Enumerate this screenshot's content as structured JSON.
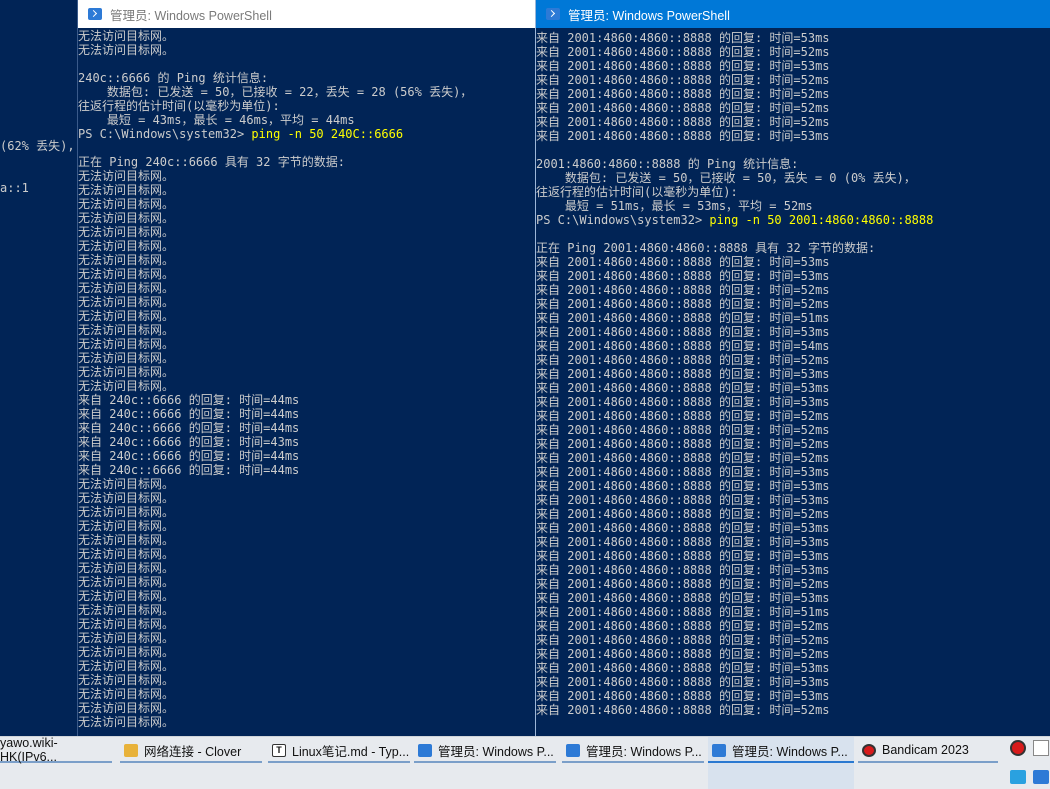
{
  "behind_window": {
    "lines": [
      "",
      "",
      "",
      "",
      "",
      "",
      "",
      "",
      "(62% 丢失),",
      "",
      "",
      "a::1"
    ]
  },
  "left_window": {
    "title": "管理员: Windows PowerShell",
    "lines": [
      {
        "t": "无法访问目标网。"
      },
      {
        "t": "无法访问目标网。"
      },
      {
        "t": ""
      },
      {
        "t": "240c::6666 的 Ping 统计信息:"
      },
      {
        "t": "    数据包: 已发送 = 50，已接收 = 22，丢失 = 28 (56% 丢失)，"
      },
      {
        "t": "往返行程的估计时间(以毫秒为单位):"
      },
      {
        "t": "    最短 = 43ms，最长 = 46ms，平均 = 44ms"
      },
      {
        "t": "PS C:\\Windows\\system32> ",
        "cmd": "ping -n 50 240C::6666"
      },
      {
        "t": ""
      },
      {
        "t": "正在 Ping 240c::6666 具有 32 字节的数据:"
      },
      {
        "t": "无法访问目标网。"
      },
      {
        "t": "无法访问目标网。"
      },
      {
        "t": "无法访问目标网。"
      },
      {
        "t": "无法访问目标网。"
      },
      {
        "t": "无法访问目标网。"
      },
      {
        "t": "无法访问目标网。"
      },
      {
        "t": "无法访问目标网。"
      },
      {
        "t": "无法访问目标网。"
      },
      {
        "t": "无法访问目标网。"
      },
      {
        "t": "无法访问目标网。"
      },
      {
        "t": "无法访问目标网。"
      },
      {
        "t": "无法访问目标网。"
      },
      {
        "t": "无法访问目标网。"
      },
      {
        "t": "无法访问目标网。"
      },
      {
        "t": "无法访问目标网。"
      },
      {
        "t": "无法访问目标网。"
      },
      {
        "t": "来自 240c::6666 的回复: 时间=44ms"
      },
      {
        "t": "来自 240c::6666 的回复: 时间=44ms"
      },
      {
        "t": "来自 240c::6666 的回复: 时间=44ms"
      },
      {
        "t": "来自 240c::6666 的回复: 时间=43ms"
      },
      {
        "t": "来自 240c::6666 的回复: 时间=44ms"
      },
      {
        "t": "来自 240c::6666 的回复: 时间=44ms"
      },
      {
        "t": "无法访问目标网。"
      },
      {
        "t": "无法访问目标网。"
      },
      {
        "t": "无法访问目标网。"
      },
      {
        "t": "无法访问目标网。"
      },
      {
        "t": "无法访问目标网。"
      },
      {
        "t": "无法访问目标网。"
      },
      {
        "t": "无法访问目标网。"
      },
      {
        "t": "无法访问目标网。"
      },
      {
        "t": "无法访问目标网。"
      },
      {
        "t": "无法访问目标网。"
      },
      {
        "t": "无法访问目标网。"
      },
      {
        "t": "无法访问目标网。"
      },
      {
        "t": "无法访问目标网。"
      },
      {
        "t": "无法访问目标网。"
      },
      {
        "t": "无法访问目标网。"
      },
      {
        "t": "无法访问目标网。"
      },
      {
        "t": "无法访问目标网。"
      },
      {
        "t": "无法访问目标网。"
      }
    ]
  },
  "right_window": {
    "title": "管理员: Windows PowerShell",
    "lines": [
      {
        "t": "来自 2001:4860:4860::8888 的回复: 时间=53ms"
      },
      {
        "t": "来自 2001:4860:4860::8888 的回复: 时间=52ms"
      },
      {
        "t": "来自 2001:4860:4860::8888 的回复: 时间=53ms"
      },
      {
        "t": "来自 2001:4860:4860::8888 的回复: 时间=52ms"
      },
      {
        "t": "来自 2001:4860:4860::8888 的回复: 时间=52ms"
      },
      {
        "t": "来自 2001:4860:4860::8888 的回复: 时间=52ms"
      },
      {
        "t": "来自 2001:4860:4860::8888 的回复: 时间=52ms"
      },
      {
        "t": "来自 2001:4860:4860::8888 的回复: 时间=53ms"
      },
      {
        "t": ""
      },
      {
        "t": "2001:4860:4860::8888 的 Ping 统计信息:"
      },
      {
        "t": "    数据包: 已发送 = 50，已接收 = 50，丢失 = 0 (0% 丢失)，"
      },
      {
        "t": "往返行程的估计时间(以毫秒为单位):"
      },
      {
        "t": "    最短 = 51ms，最长 = 53ms，平均 = 52ms"
      },
      {
        "t": "PS C:\\Windows\\system32> ",
        "cmd": "ping -n 50 2001:4860:4860::8888"
      },
      {
        "t": ""
      },
      {
        "t": "正在 Ping 2001:4860:4860::8888 具有 32 字节的数据:"
      },
      {
        "t": "来自 2001:4860:4860::8888 的回复: 时间=53ms"
      },
      {
        "t": "来自 2001:4860:4860::8888 的回复: 时间=53ms"
      },
      {
        "t": "来自 2001:4860:4860::8888 的回复: 时间=52ms"
      },
      {
        "t": "来自 2001:4860:4860::8888 的回复: 时间=52ms"
      },
      {
        "t": "来自 2001:4860:4860::8888 的回复: 时间=51ms"
      },
      {
        "t": "来自 2001:4860:4860::8888 的回复: 时间=53ms"
      },
      {
        "t": "来自 2001:4860:4860::8888 的回复: 时间=54ms"
      },
      {
        "t": "来自 2001:4860:4860::8888 的回复: 时间=52ms"
      },
      {
        "t": "来自 2001:4860:4860::8888 的回复: 时间=53ms"
      },
      {
        "t": "来自 2001:4860:4860::8888 的回复: 时间=53ms"
      },
      {
        "t": "来自 2001:4860:4860::8888 的回复: 时间=53ms"
      },
      {
        "t": "来自 2001:4860:4860::8888 的回复: 时间=52ms"
      },
      {
        "t": "来自 2001:4860:4860::8888 的回复: 时间=52ms"
      },
      {
        "t": "来自 2001:4860:4860::8888 的回复: 时间=52ms"
      },
      {
        "t": "来自 2001:4860:4860::8888 的回复: 时间=52ms"
      },
      {
        "t": "来自 2001:4860:4860::8888 的回复: 时间=53ms"
      },
      {
        "t": "来自 2001:4860:4860::8888 的回复: 时间=53ms"
      },
      {
        "t": "来自 2001:4860:4860::8888 的回复: 时间=53ms"
      },
      {
        "t": "来自 2001:4860:4860::8888 的回复: 时间=52ms"
      },
      {
        "t": "来自 2001:4860:4860::8888 的回复: 时间=53ms"
      },
      {
        "t": "来自 2001:4860:4860::8888 的回复: 时间=53ms"
      },
      {
        "t": "来自 2001:4860:4860::8888 的回复: 时间=53ms"
      },
      {
        "t": "来自 2001:4860:4860::8888 的回复: 时间=53ms"
      },
      {
        "t": "来自 2001:4860:4860::8888 的回复: 时间=52ms"
      },
      {
        "t": "来自 2001:4860:4860::8888 的回复: 时间=53ms"
      },
      {
        "t": "来自 2001:4860:4860::8888 的回复: 时间=51ms"
      },
      {
        "t": "来自 2001:4860:4860::8888 的回复: 时间=52ms"
      },
      {
        "t": "来自 2001:4860:4860::8888 的回复: 时间=52ms"
      },
      {
        "t": "来自 2001:4860:4860::8888 的回复: 时间=52ms"
      },
      {
        "t": "来自 2001:4860:4860::8888 的回复: 时间=53ms"
      },
      {
        "t": "来自 2001:4860:4860::8888 的回复: 时间=53ms"
      },
      {
        "t": "来自 2001:4860:4860::8888 的回复: 时间=53ms"
      },
      {
        "t": "来自 2001:4860:4860::8888 的回复: 时间=52ms"
      }
    ]
  },
  "taskbar": {
    "items": [
      {
        "label": "yawo.wiki-HK(IPv6...",
        "icon": "browser-icon",
        "active": false
      },
      {
        "label": "网络连接 - Clover",
        "icon": "folder-icon",
        "active": false
      },
      {
        "label": "Linux笔记.md - Typ...",
        "icon": "typora-icon",
        "active": false
      },
      {
        "label": "管理员: Windows P...",
        "icon": "powershell-icon",
        "active": false
      },
      {
        "label": "管理员: Windows P...",
        "icon": "powershell-icon",
        "active": false
      },
      {
        "label": "管理员: Windows P...",
        "icon": "powershell-icon",
        "active": true
      },
      {
        "label": "Bandicam 2023",
        "icon": "bandicam-icon",
        "active": false
      }
    ]
  },
  "colors": {
    "console_bg": "#012456",
    "command": "#ffff00",
    "accent": "#0078d7"
  }
}
